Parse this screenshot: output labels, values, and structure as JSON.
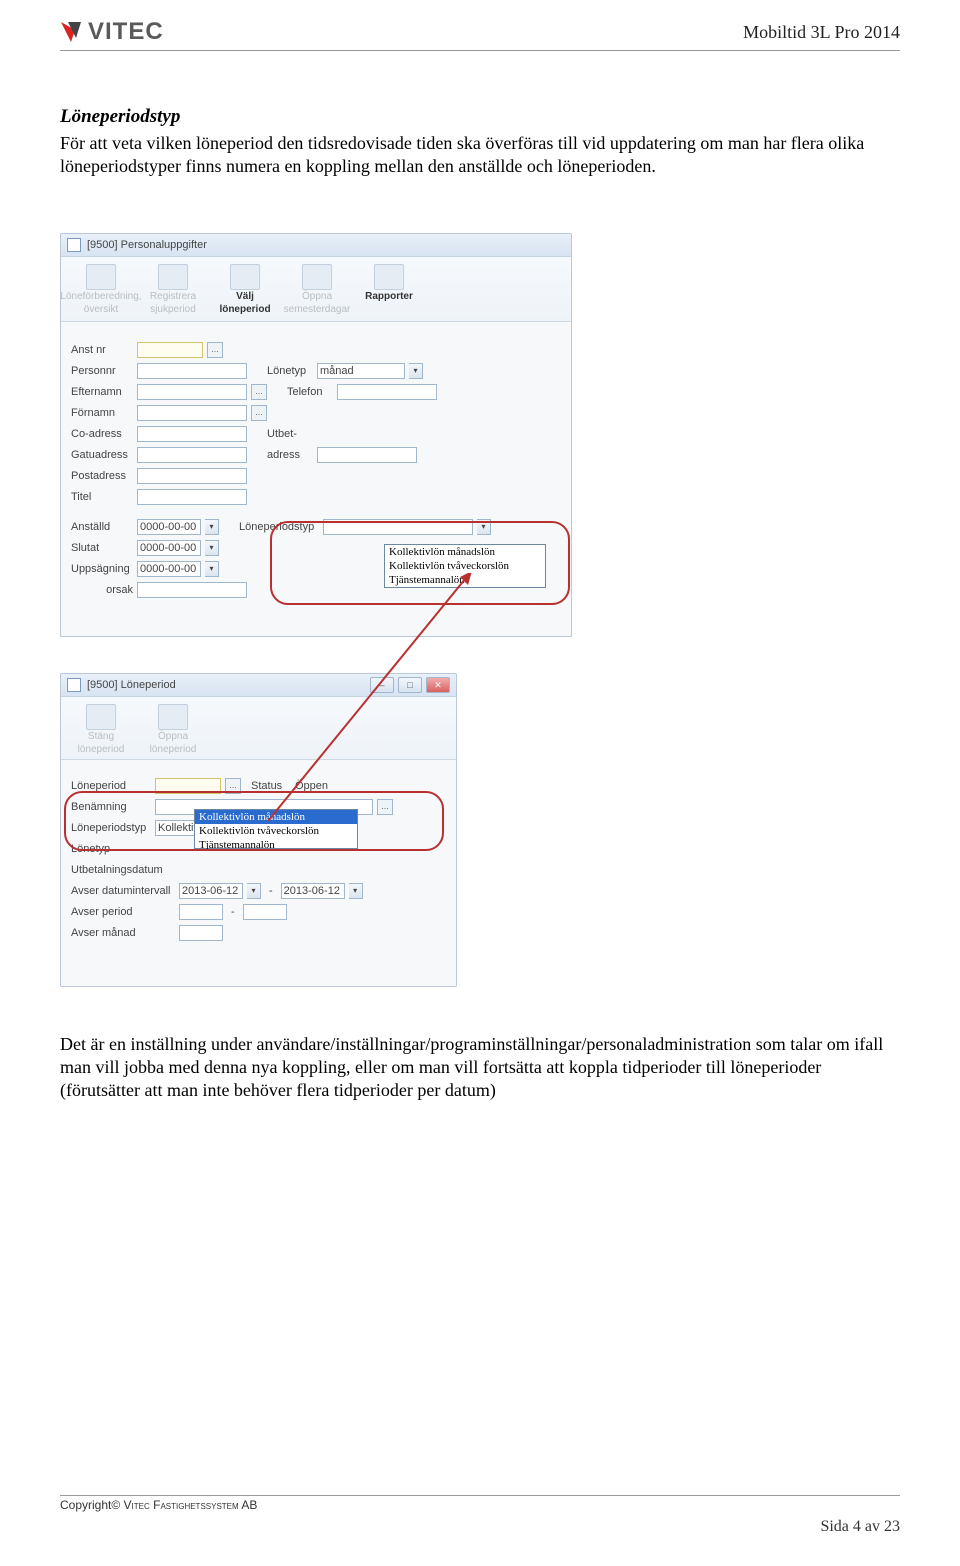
{
  "header": {
    "brand": "VITEC",
    "right": "Mobiltid 3L Pro 2014"
  },
  "section_title": "Löneperiodstyp",
  "para1": "För att veta vilken löneperiod den tidsredovisade tiden ska överföras till vid uppdatering om man har flera olika löneperiodstyper finns numera en koppling mellan den anställde och löneperioden.",
  "win1": {
    "title": "[9500] Personaluppgifter",
    "toolbar": [
      {
        "label1": "Löneförberedning,",
        "label2": "översikt",
        "mode": "disabled"
      },
      {
        "label1": "Registrera",
        "label2": "sjukperiod",
        "mode": "disabled"
      },
      {
        "label1": "Välj",
        "label2": "löneperiod",
        "mode": "strong"
      },
      {
        "label1": "Öppna",
        "label2": "semesterdagar",
        "mode": "disabled"
      },
      {
        "label1": "Rapporter",
        "label2": "",
        "mode": "strong"
      }
    ],
    "fields": {
      "anst_nr": "Anst nr",
      "personnr": "Personnr",
      "lonetyp": "Lönetyp",
      "lonetyp_val": "månad",
      "efternamn": "Efternamn",
      "telefon": "Telefon",
      "fornamn": "Förnamn",
      "coadress": "Co-adress",
      "utbet": "Utbet-",
      "utbet2": "adress",
      "gatu": "Gatuadress",
      "post": "Postadress",
      "titel": "Titel",
      "anstald": "Anställd",
      "anstald_v": "0000-00-00",
      "slutat": "Slutat",
      "slutat_v": "0000-00-00",
      "upps": "Uppsägning",
      "upps_v": "0000-00-00",
      "orsak": "orsak",
      "lptyp": "Löneperiodstyp"
    },
    "drop_items": [
      "Kollektivlön månadslön",
      "Kollektivlön tvåveckorslön",
      "Tjänstemannalön"
    ]
  },
  "win2": {
    "title": "[9500] Löneperiod",
    "toolbar": [
      {
        "label1": "Stäng",
        "label2": "löneperiod",
        "mode": "disabled"
      },
      {
        "label1": "Öppna",
        "label2": "löneperiod",
        "mode": "disabled"
      }
    ],
    "fields": {
      "lp": "Löneperiod",
      "status": "Status",
      "status_v": "Öppen",
      "ben": "Benämning",
      "lptyp": "Löneperiodstyp",
      "lptyp_v": "Kollektivlön månadslön",
      "lonetyp": "Lönetyp",
      "utbet": "Utbetalningsdatum",
      "avserint": "Avser datumintervall",
      "date1": "2013-06-12",
      "dash": "-",
      "date2": "2013-06-12",
      "avserp": "Avser period",
      "avserm": "Avser månad"
    },
    "drop_items": [
      "Kollektivlön månadslön",
      "Kollektivlön tvåveckorslön",
      "Tjänstemannalön"
    ]
  },
  "para2": "Det är en inställning under användare/inställningar/programinställningar/personaladministration som talar om ifall man vill jobba med denna nya koppling, eller om man vill fortsätta att koppla tidperioder till löneperioder (förutsätter att man inte behöver flera tidperioder per datum)",
  "footer": {
    "left": "Copyright© VITEC FASTIGHETSSYSTEM AB",
    "right": "Sida 4 av 23"
  }
}
